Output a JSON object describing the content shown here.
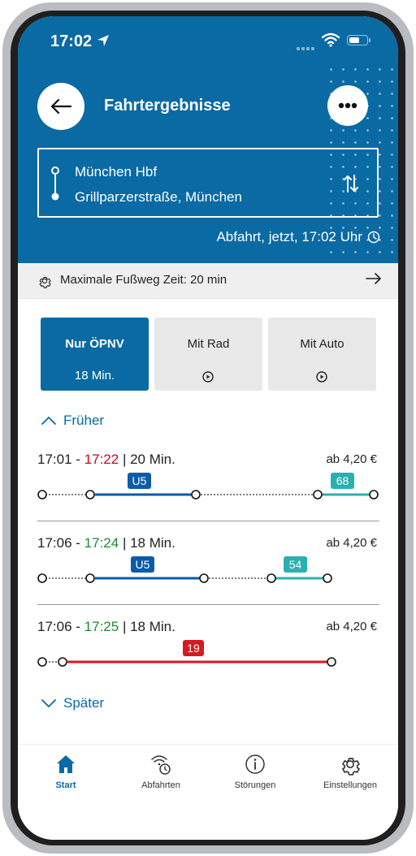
{
  "status": {
    "time": "17:02"
  },
  "header": {
    "title": "Fahrtergebnisse",
    "from": "München Hbf",
    "to": "Grillparzerstraße, München",
    "departure": "Abfahrt, jetzt, 17:02 Uhr"
  },
  "walk_bar": {
    "text": "Maximale Fußweg Zeit: 20 min"
  },
  "modes": [
    {
      "label": "Nur ÖPNV",
      "sub": "18 Min."
    },
    {
      "label": "Mit Rad"
    },
    {
      "label": "Mit Auto"
    }
  ],
  "earlier_label": "Früher",
  "later_label": "Später",
  "trips": [
    {
      "dep": "17:01",
      "arr": "17:22",
      "dur": "| 20 Min.",
      "price": "ab 4,20 €",
      "badges": [
        "U5",
        "68"
      ]
    },
    {
      "dep": "17:06",
      "arr": "17:24",
      "dur": "| 18 Min.",
      "price": "ab 4,20 €",
      "badges": [
        "U5",
        "54"
      ]
    },
    {
      "dep": "17:06",
      "arr": "17:25",
      "dur": "| 18 Min.",
      "price": "ab 4,20 €",
      "badges": [
        "19"
      ]
    }
  ],
  "tabs": [
    {
      "label": "Start"
    },
    {
      "label": "Abfahrten"
    },
    {
      "label": "Störungen"
    },
    {
      "label": "Einstellungen"
    }
  ],
  "colors": {
    "primary": "#0a6aa3",
    "ubahn": "#0b5ba8",
    "bus": "#2ab0b0",
    "tram": "#d71920",
    "delay": "#d0021b",
    "ontime": "#1e8a2a"
  }
}
